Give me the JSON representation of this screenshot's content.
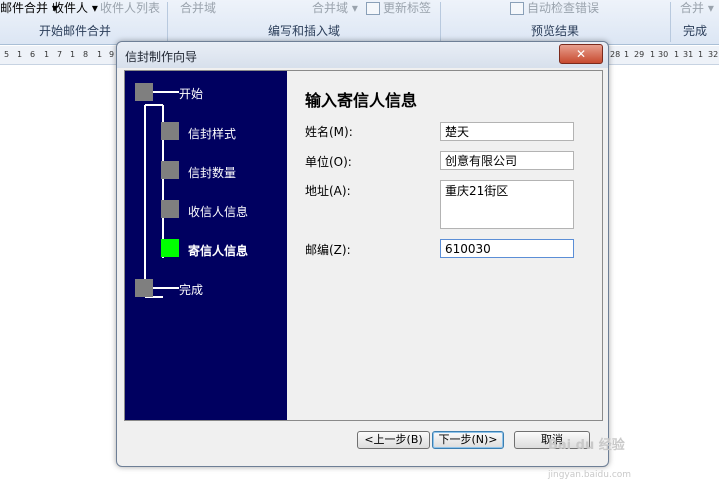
{
  "ribbon": {
    "top_items": [
      "邮件合并",
      "收件人",
      "收件人列表",
      "合并域",
      "合并域",
      "更新标签",
      "自动检查错误",
      "合并"
    ],
    "groups": [
      "开始邮件合并",
      "编写和插入域",
      "预览结果",
      "完成"
    ]
  },
  "ruler": {
    "left_ticks": [
      "5",
      "1",
      "6",
      "1",
      "7",
      "1",
      "8",
      "1",
      "9"
    ],
    "right_ticks": [
      "28",
      "1",
      "29",
      "1",
      "30",
      "1",
      "31",
      "1",
      "32"
    ]
  },
  "dialog": {
    "title": "信封制作向导",
    "close_glyph": "✕",
    "steps": [
      "开始",
      "信封样式",
      "信封数量",
      "收信人信息",
      "寄信人信息",
      "完成"
    ],
    "current_step": "寄信人信息",
    "panel_title": "输入寄信人信息",
    "fields": {
      "name_label": "姓名(M):",
      "name_value": "楚天",
      "company_label": "单位(O):",
      "company_value": "创意有限公司",
      "address_label": "地址(A):",
      "address_value": "重庆21街区",
      "zip_label": "邮编(Z):",
      "zip_value": "610030"
    },
    "buttons": {
      "back": "<上一步(B)",
      "next": "下一步(N)>",
      "cancel": "取消"
    }
  },
  "watermark": {
    "text": "Bai du 经验",
    "url": "jingyan.baidu.com"
  }
}
